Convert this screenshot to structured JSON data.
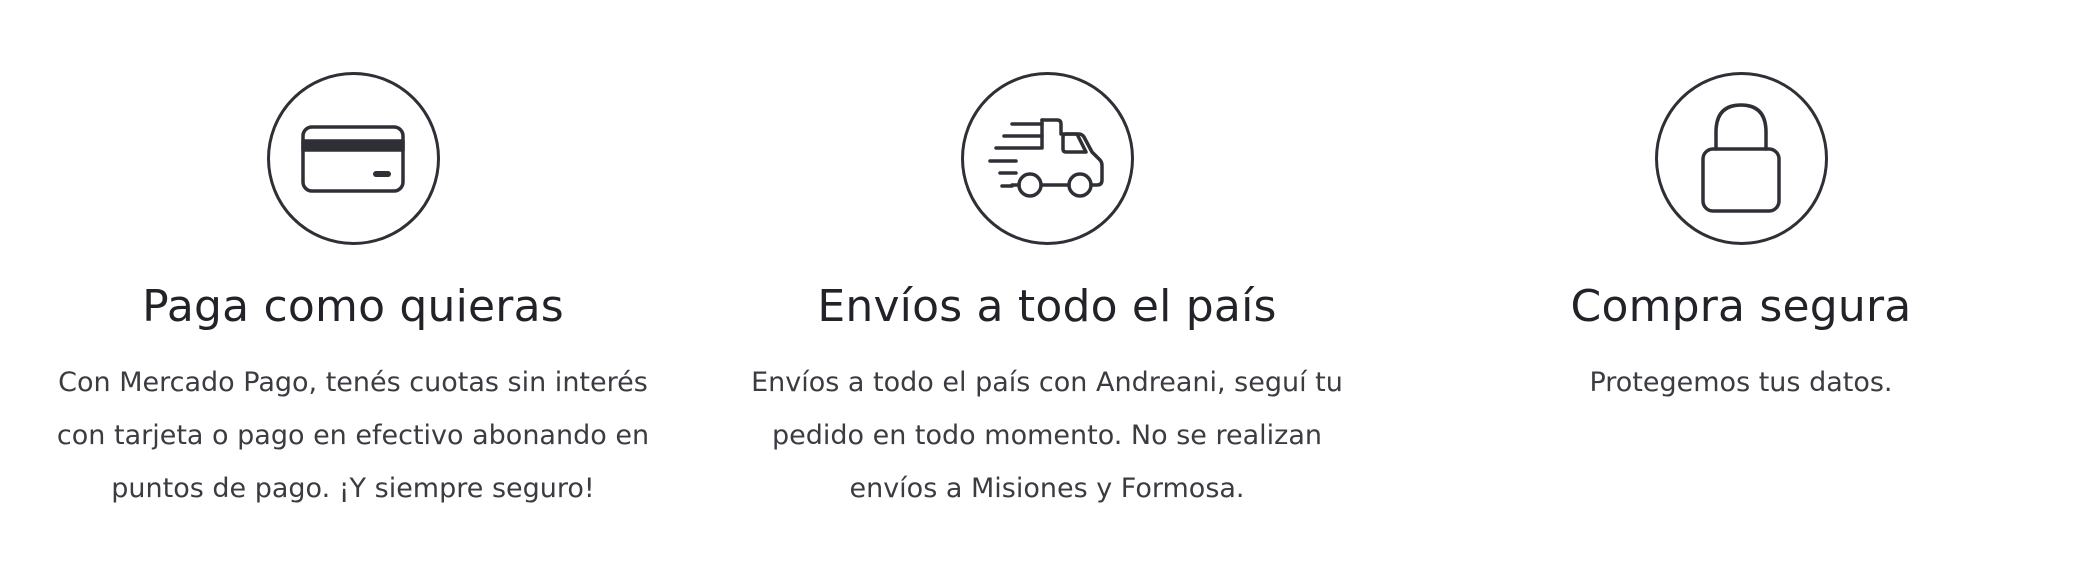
{
  "features": [
    {
      "icon": "credit-card-icon",
      "title": "Paga como quieras",
      "text_lines": [
        "Con Mercado Pago, tenés cuotas sin interés",
        "con tarjeta o pago en efectivo abonando en",
        "puntos de pago. ¡Y siempre seguro!"
      ]
    },
    {
      "icon": "delivery-truck-icon",
      "title": "Envíos a todo el país",
      "text_lines": [
        "Envíos a todo el país con Andreani, seguí tu",
        "pedido en todo momento. No se realizan",
        "envíos a Misiones y Formosa."
      ]
    },
    {
      "icon": "padlock-icon",
      "title": "Compra segura",
      "text_lines": [
        "Protegemos tus datos."
      ]
    }
  ],
  "colors": {
    "icon_stroke": "#2e3036",
    "title": "#222328",
    "text": "#3b3c42",
    "background": "#ffffff"
  }
}
